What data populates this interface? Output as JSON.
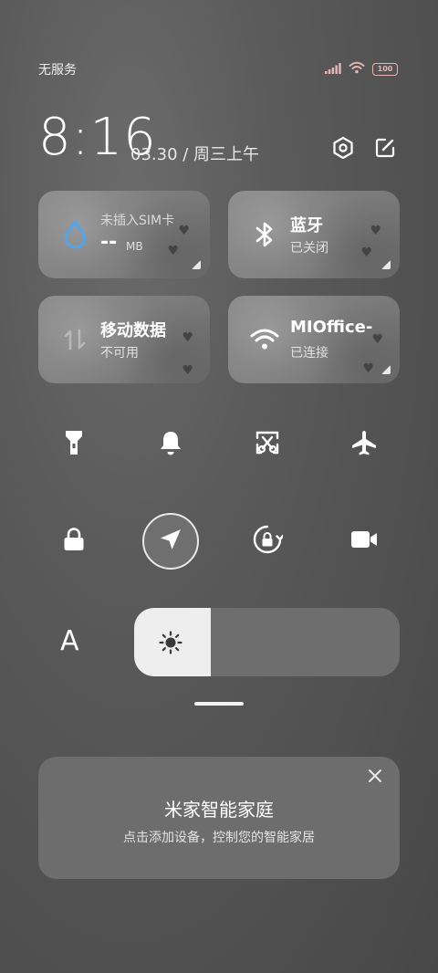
{
  "status_bar": {
    "carrier": "无服务",
    "battery": "100",
    "icons": [
      "signal-icon",
      "wifi-icon",
      "battery-icon"
    ]
  },
  "header": {
    "time": "8:16",
    "date": "03.30 / 周三上午",
    "icons": [
      "settings-icon",
      "edit-icon"
    ]
  },
  "tiles": [
    {
      "name": "sim",
      "title": "未插入SIM卡",
      "value": "--",
      "unit": "MB",
      "icon": "water-drop-icon",
      "accent": "#4ea6f0"
    },
    {
      "name": "bluetooth",
      "title": "蓝牙",
      "sub": "已关闭",
      "icon": "bluetooth-icon"
    },
    {
      "name": "mobile-data",
      "title": "移动数据",
      "sub": "不可用",
      "icon": "data-arrows-icon"
    },
    {
      "name": "wifi",
      "title": "MIOffice-",
      "sub": "已连接",
      "icon": "wifi-icon"
    }
  ],
  "toggles_row1": [
    "flashlight-icon",
    "bell-icon",
    "screenshot-icon",
    "airplane-icon"
  ],
  "toggles_row2": [
    "lock-icon",
    "location-icon",
    "rotation-lock-icon",
    "video-camera-icon"
  ],
  "brightness": {
    "level": 0.29,
    "auto_label": "A",
    "icon": "sun-icon"
  },
  "card": {
    "title": "米家智能家庭",
    "description": "点击添加设备，控制您的智能家居"
  },
  "colors": {
    "accent_blue": "#4ea6f0",
    "battery": "#e6b4b4"
  }
}
